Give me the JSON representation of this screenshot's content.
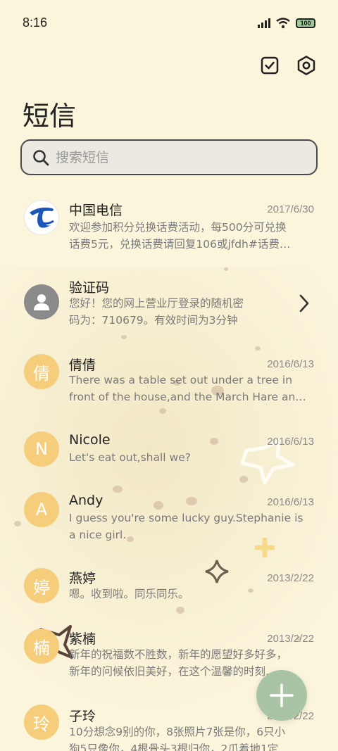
{
  "status": {
    "time": "8:16",
    "battery": "100"
  },
  "page": {
    "title": "短信"
  },
  "search": {
    "placeholder": "搜索短信"
  },
  "messages": [
    {
      "name": "中国电信",
      "date": "2017/6/30",
      "line1": "欢迎参加积分兑换话费活动，每500分可兑换",
      "line2": "话费5元，兑换话费请回复106或jfdh#话费…",
      "avatar": ""
    },
    {
      "name": "验证码",
      "date": "",
      "line1": "您好！您的网上营业厅登录的随机密",
      "line2": "码为：710679。有效时间为3分钟",
      "avatar": ""
    },
    {
      "name": "倩倩",
      "date": "2016/6/13",
      "line1": "There was a table set out under a tree in",
      "line2": "front of the house,and the March Hare an…",
      "avatar": "倩"
    },
    {
      "name": "Nicole",
      "date": "2016/6/13",
      "line1": "Let's eat out,shall we?",
      "line2": "",
      "avatar": "N"
    },
    {
      "name": "Andy",
      "date": "2016/6/13",
      "line1": "I guess you're some lucky guy.Stephanie is",
      "line2": "a nice girl.",
      "avatar": "A"
    },
    {
      "name": "燕婷",
      "date": "2013/2/22",
      "line1": "嗯。收到啦。同乐同乐。",
      "line2": "",
      "avatar": "婷"
    },
    {
      "name": "紫楠",
      "date": "2013/2/22",
      "line1": "新年的祝福数不胜数，新年的愿望好多好多，",
      "line2": "新年的问候依旧美好，在这个温馨的时刻…",
      "avatar": "楠"
    },
    {
      "name": "子玲",
      "date": "2013/2/22",
      "line1": "10分想念9别的你，8张照片7张是你，6只小",
      "line2": "狗5只像你，4根骨头3根归你，2爪着地1定",
      "avatar": "玲"
    }
  ]
}
